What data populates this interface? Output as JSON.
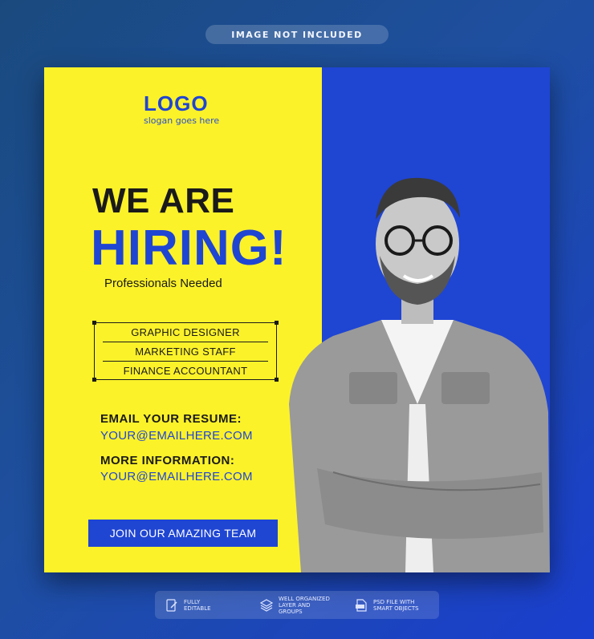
{
  "top_notice": "IMAGE NOT INCLUDED",
  "logo": {
    "text": "LOGO",
    "slogan": "slogan goes here"
  },
  "headline": {
    "line1": "WE ARE",
    "line2": "HIRING!"
  },
  "subtitle": "Professionals Needed",
  "jobs": [
    "GRAPHIC DESIGNER",
    "MARKETING STAFF",
    "FINANCE ACCOUNTANT"
  ],
  "contact": {
    "resume_label": "EMAIL YOUR RESUME:",
    "resume_email": "YOUR@EMAILHERE.COM",
    "info_label": "MORE INFORMATION:",
    "info_email": "YOUR@EMAILHERE.COM"
  },
  "cta": "JOIN OUR AMAZING TEAM",
  "features": [
    {
      "icon": "edit-document-icon",
      "text_line1": "FULLY",
      "text_line2": "EDITABLE"
    },
    {
      "icon": "layers-icon",
      "text_line1": "WELL ORGANIZED",
      "text_line2": "LAYER AND GROUPS"
    },
    {
      "icon": "psd-file-icon",
      "text_line1": "PSD FILE WITH",
      "text_line2": "SMART OBJECTS"
    }
  ],
  "colors": {
    "yellow": "#fcf22a",
    "blue": "#1f45d3",
    "dark": "#1a1a1a"
  }
}
